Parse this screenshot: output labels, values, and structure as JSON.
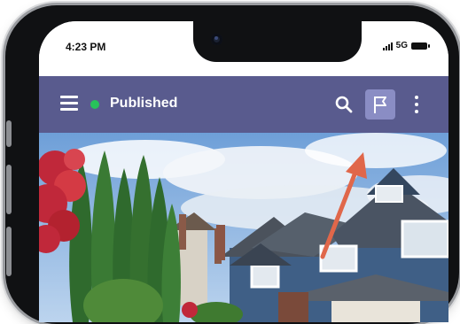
{
  "status_bar": {
    "time": "4:23 PM",
    "network": "5G"
  },
  "app_bar": {
    "menu_icon": "hamburger-menu-icon",
    "status_label": "Published",
    "status_color": "#27c25a",
    "background_color": "#595b8e",
    "actions": [
      {
        "name": "search",
        "icon": "search-icon"
      },
      {
        "name": "flag",
        "icon": "flag-icon",
        "highlighted": true
      },
      {
        "name": "more",
        "icon": "more-vertical-icon"
      }
    ]
  },
  "hero_image": {
    "subject": "suburban house with blue siding, tall cypress trees and a red maple",
    "annotation_arrow_color": "#e0674a"
  }
}
